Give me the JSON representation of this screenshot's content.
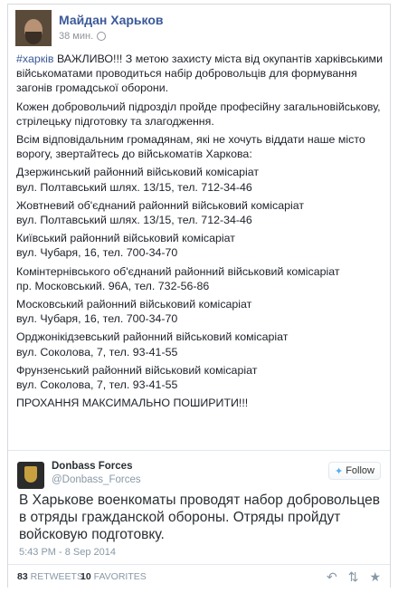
{
  "facebook_post": {
    "page_name": "Майдан Харьков",
    "time": "38 мин.",
    "hashtag": "#харків",
    "intro_rest": " ВАЖЛИВО!!! З метою захисту міста від окупантів харківськими військоматами проводиться набір добровольців для формування загонів громадської оборони.",
    "para2": "Кожен добровольчий підрозділ пройде професійну загальновійськову, стрілецьку підготовку та злагодження.",
    "para3": "Всім відповідальним громадянам, які не хочуть віддати наше місто ворогу, звертайтесь до військоматів Харкова:",
    "offices": [
      {
        "name": "Дзержинський районний військовий комісаріат",
        "address": "вул. Полтавський шлях. 13/15, тел. 712-34-46"
      },
      {
        "name": "Жовтневий об'єднаний районний військовий комісаріат",
        "address": "вул. Полтавський шлях. 13/15, тел. 712-34-46"
      },
      {
        "name": "Київський районний військовий комісаріат",
        "address": "вул. Чубаря, 16, тел. 700-34-70"
      },
      {
        "name": "Комінтернівського об'єднаний районний військовий комісаріат",
        "address": "пр. Московський. 96А, тел. 732-56-86"
      },
      {
        "name": "Московський районний військовий комісаріат",
        "address": "вул. Чубаря, 16, тел. 700-34-70"
      },
      {
        "name": "Орджонікідзевський районний військовий комісаріат",
        "address": "вул. Соколова, 7, тел. 93-41-55"
      },
      {
        "name": "Фрунзенський районний військовий комісаріат",
        "address": "вул. Соколова, 7, тел. 93-41-55"
      }
    ],
    "closing": "ПРОХАННЯ МАКСИМАЛЬНО ПОШИРИТИ!!!"
  },
  "tweet": {
    "name": "Donbass Forces",
    "handle": "@Donbass_Forces",
    "follow_label": "Follow",
    "text": "В Харькове военкоматы проводят набор добровольцев в отряды гражданской обороны. Отряды пройдут войсковую подготовку.",
    "date": "5:43 PM - 8 Sep 2014",
    "retweets_count": "83",
    "retweets_label": "RETWEETS",
    "favorites_count": "10",
    "favorites_label": "FAVORITES",
    "icons": [
      "reply-icon",
      "retweet-icon",
      "favorite-icon"
    ]
  },
  "colors": {
    "facebook_link": "#3b5998",
    "twitter_blue": "#55acee"
  }
}
